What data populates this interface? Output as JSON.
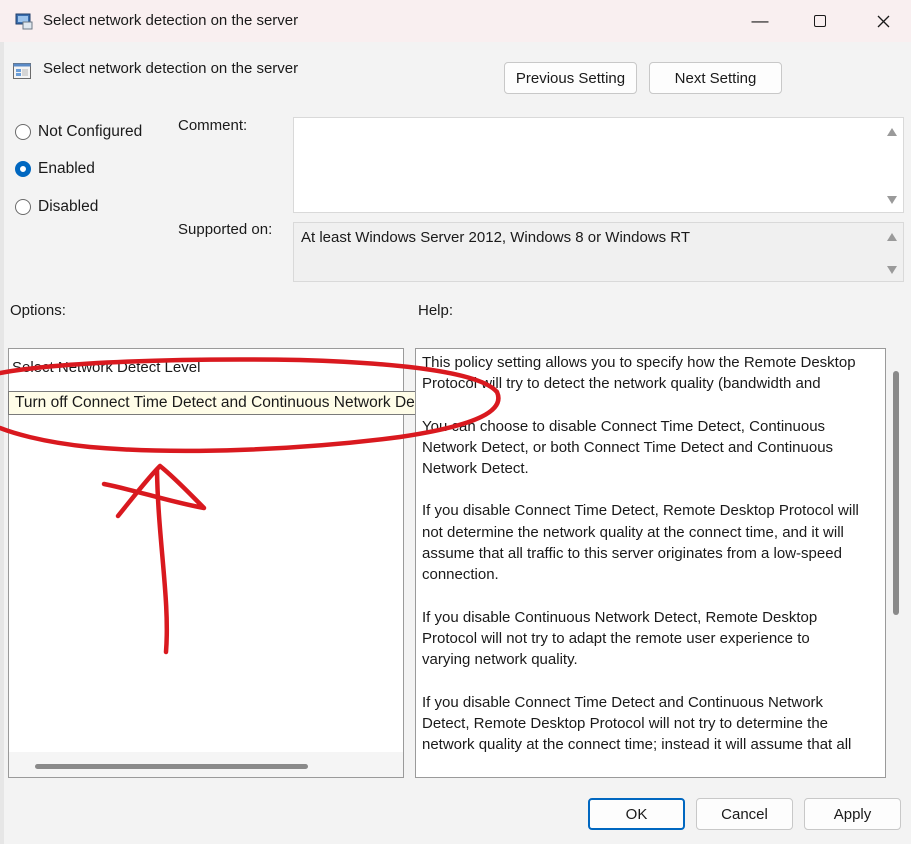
{
  "window": {
    "title": "Select network detection on the server",
    "minimize_glyph": "—",
    "maximize_glyph": "☐",
    "close_glyph": "✕"
  },
  "header": {
    "policy_name": "Select network detection on the server",
    "previous_setting_label": "Previous Setting",
    "next_setting_label": "Next Setting"
  },
  "state": {
    "options": [
      {
        "label": "Not Configured",
        "checked": false
      },
      {
        "label": "Enabled",
        "checked": true
      },
      {
        "label": "Disabled",
        "checked": false
      }
    ]
  },
  "comment": {
    "label": "Comment:",
    "value": ""
  },
  "supported": {
    "label": "Supported on:",
    "value": "At least Windows Server 2012, Windows 8 or Windows RT"
  },
  "options_panel": {
    "label": "Options:",
    "field_label": "Select Network Detect Level",
    "dropdown_value": "Turn off Connect Time Detect and Continuous Network Detect"
  },
  "help_panel": {
    "label": "Help:",
    "paragraphs": [
      "This policy setting allows you to specify how the Remote Desktop Protocol will try to detect the network quality (bandwidth and",
      "You can choose to disable Connect Time Detect, Continuous Network Detect, or both Connect Time Detect and Continuous Network Detect.",
      "If you disable Connect Time Detect, Remote Desktop Protocol will not determine the network quality at the connect time, and it will assume that all traffic to this server originates from a low-speed connection.",
      "If you disable Continuous Network Detect, Remote Desktop Protocol will not try to adapt the remote user experience to varying network quality.",
      "If you disable Connect Time Detect and Continuous Network Detect, Remote Desktop Protocol will not try to determine the network quality at the connect time; instead it will assume that all"
    ]
  },
  "footer": {
    "ok_label": "OK",
    "cancel_label": "Cancel",
    "apply_label": "Apply"
  },
  "colors": {
    "accent": "#0067c0",
    "annotation": "#d9191f",
    "titlebar": "#f9eff0"
  }
}
